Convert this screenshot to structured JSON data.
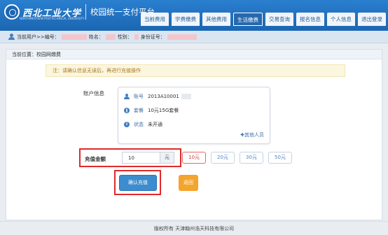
{
  "header": {
    "school_name": "西北工业大学",
    "school_name_en": "NORTHWESTERN POLYTECHNICAL UNIVERSITY",
    "system_title": "校园统一支付平台"
  },
  "nav": {
    "tabs": [
      {
        "label": "当前费用",
        "active": false
      },
      {
        "label": "学费缴费",
        "active": false
      },
      {
        "label": "其他费用",
        "active": false
      },
      {
        "label": "生活缴费",
        "active": true
      },
      {
        "label": "交易查询",
        "active": false
      },
      {
        "label": "报名信息",
        "active": false
      },
      {
        "label": "个人信息",
        "active": false
      },
      {
        "label": "退出登录",
        "active": false
      }
    ]
  },
  "userbar": {
    "current_user": "当前用户>>编号：",
    "name_label": "姓名：",
    "gender_label": "性别：",
    "id_label": "身份证号："
  },
  "page": {
    "location": "当前位置：校园网缴费",
    "notice": "注：请确认信息无误后，再进行充值操作"
  },
  "account": {
    "label": "账户信息",
    "rows": [
      {
        "icon": "user-icon",
        "key": "账号",
        "value": "2013A10001"
      },
      {
        "icon": "globe-icon",
        "key": "套餐",
        "value": "10元15G套餐"
      },
      {
        "icon": "info-icon",
        "key": "状态",
        "value": "未开通"
      }
    ],
    "other_user": "✚其他人员"
  },
  "recharge": {
    "label": "充值金额",
    "value": "10",
    "unit": "元",
    "presets": [
      {
        "label": "10元",
        "selected": true
      },
      {
        "label": "20元",
        "selected": false
      },
      {
        "label": "30元",
        "selected": false
      },
      {
        "label": "50元",
        "selected": false
      }
    ]
  },
  "buttons": {
    "confirm": "确认充值",
    "back": "返回"
  },
  "footer": "版权所有 天津翰州浩天科技有限公司",
  "colors": {
    "header": "#1b66b3",
    "highlight": "#e02a2a",
    "confirm": "#3c8ccf",
    "back": "#f4a52d"
  }
}
